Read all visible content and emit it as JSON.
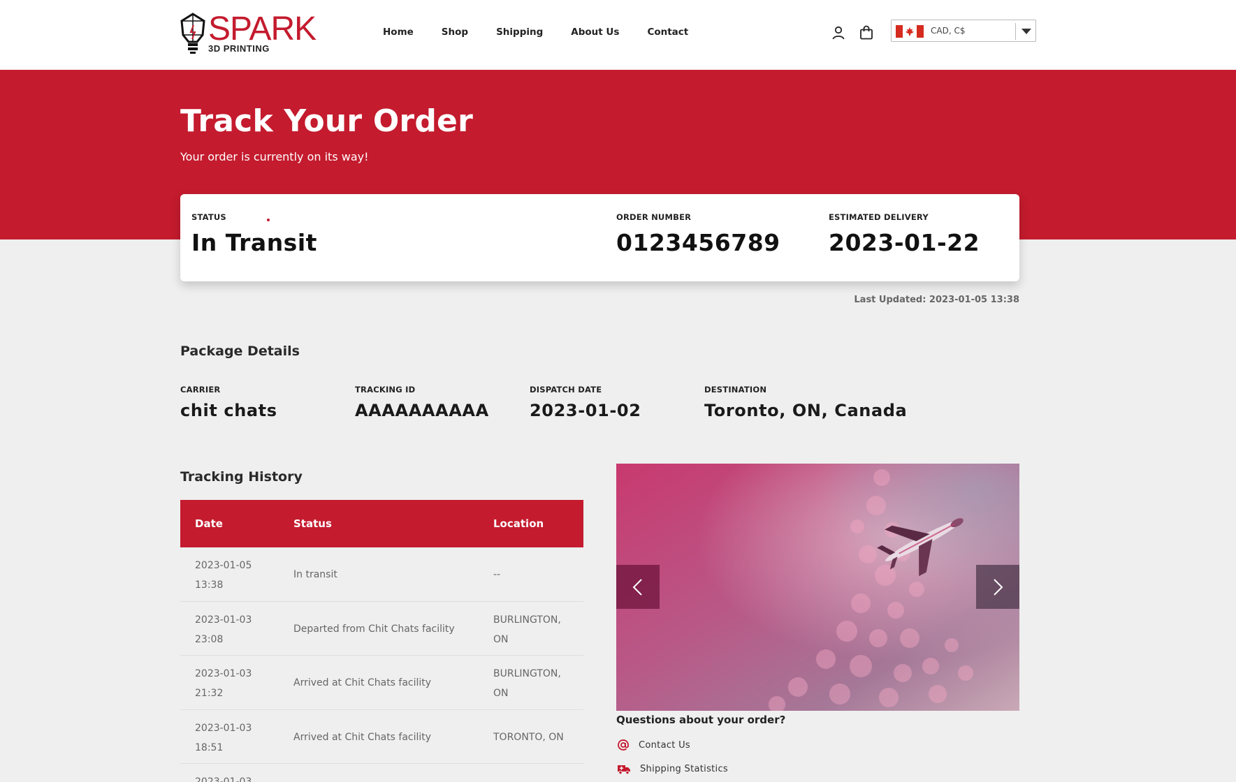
{
  "header": {
    "logo_text": "SPARK",
    "logo_subtext": "3D PRINTING",
    "nav": [
      "Home",
      "Shop",
      "Shipping",
      "About Us",
      "Contact"
    ],
    "currency": "CAD, C$"
  },
  "hero": {
    "title": "Track Your Order",
    "subtitle": "Your order is currently on its way!"
  },
  "status_card": {
    "status_label": "STATUS",
    "status_value": "In Transit",
    "order_label": "ORDER NUMBER",
    "order_value": "0123456789",
    "delivery_label": "ESTIMATED DELIVERY",
    "delivery_value": "2023-01-22"
  },
  "last_updated": "Last Updated: 2023-01-05 13:38",
  "package": {
    "title": "Package Details",
    "fields": [
      {
        "label": "CARRIER",
        "value": "chit chats"
      },
      {
        "label": "TRACKING ID",
        "value": "AAAAAAAAAA"
      },
      {
        "label": "DISPATCH DATE",
        "value": "2023-01-02"
      },
      {
        "label": "DESTINATION",
        "value": "Toronto, ON, Canada"
      }
    ]
  },
  "tracking": {
    "title": "Tracking History",
    "headers": [
      "Date",
      "Status",
      "Location"
    ],
    "rows": [
      {
        "date": "2023-01-05",
        "time": "13:38",
        "status": "In transit",
        "loc1": "--",
        "loc2": ""
      },
      {
        "date": "2023-01-03",
        "time": "23:08",
        "status": "Departed from Chit Chats facility",
        "loc1": "BURLINGTON,",
        "loc2": "ON"
      },
      {
        "date": "2023-01-03",
        "time": "21:32",
        "status": "Arrived at Chit Chats facility",
        "loc1": "BURLINGTON,",
        "loc2": "ON"
      },
      {
        "date": "2023-01-03",
        "time": "18:51",
        "status": "Arrived at Chit Chats facility",
        "loc1": "TORONTO, ON",
        "loc2": ""
      },
      {
        "date": "2023-01-03",
        "time": "",
        "status": "",
        "loc1": "",
        "loc2": ""
      }
    ]
  },
  "questions": {
    "title": "Questions about your order?",
    "links": [
      "Contact Us",
      "Shipping Statistics"
    ]
  },
  "colors": {
    "brand_red": "#c41b2e",
    "page_bg": "#efefef"
  }
}
